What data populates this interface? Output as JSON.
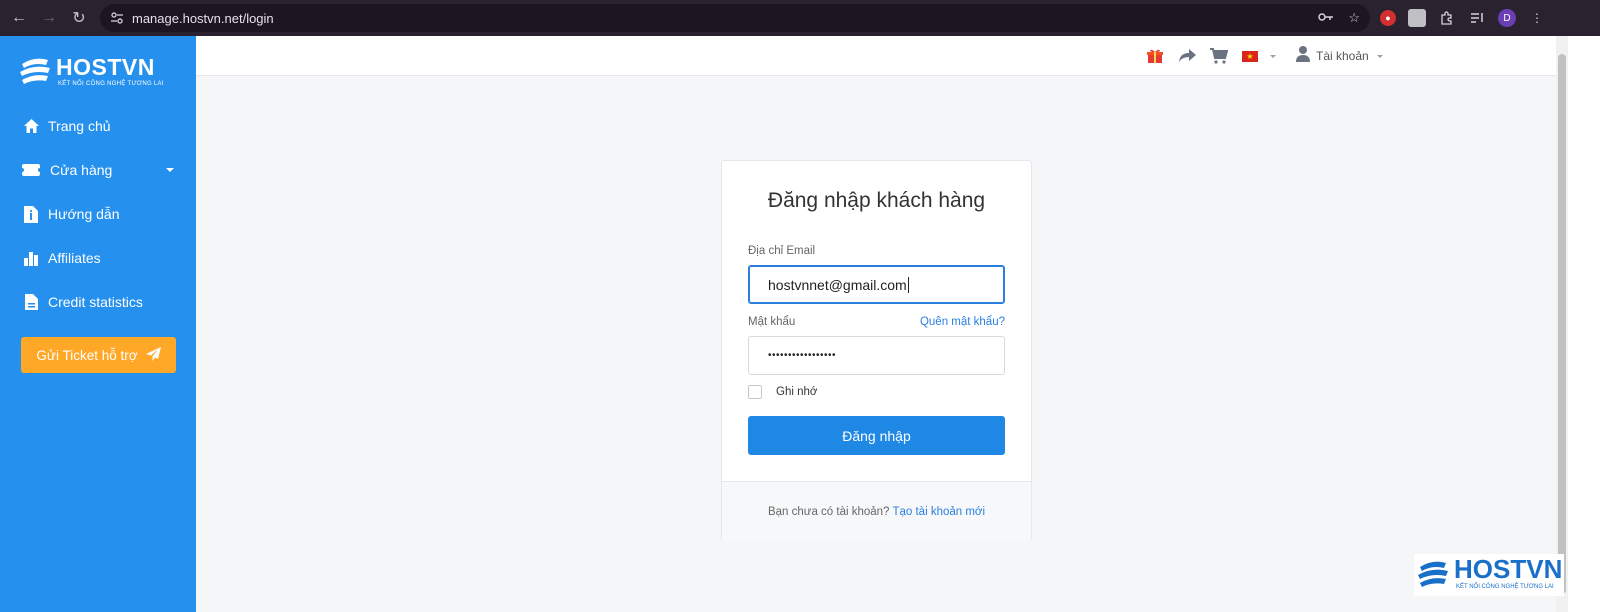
{
  "browser": {
    "url": "manage.hostvn.net/login",
    "profile_initial": "D"
  },
  "brand": {
    "name": "HOSTVN",
    "tagline": "KẾT NỐI CÔNG NGHỆ TƯƠNG LAI",
    "primary_color": "#2590ee",
    "accent_color": "#ffa726"
  },
  "sidebar": {
    "items": [
      {
        "label": "Trang chủ",
        "icon": "home-icon"
      },
      {
        "label": "Cửa hàng",
        "icon": "ticket-icon"
      },
      {
        "label": "Hướng dẫn",
        "icon": "document-info-icon"
      },
      {
        "label": "Affiliates",
        "icon": "bar-chart-icon"
      },
      {
        "label": "Credit statistics",
        "icon": "file-icon"
      }
    ],
    "ticket_button": "Gửi Ticket hỗ trợ"
  },
  "header": {
    "account_label": "Tài khoản"
  },
  "login": {
    "title": "Đăng nhập khách hàng",
    "email_label": "Địa chỉ Email",
    "email_value": "hostvnnet@gmail.com",
    "password_label": "Mật khẩu",
    "forgot_link": "Quên mật khẩu?",
    "password_mask": "•••••••••••••••••",
    "remember_label": "Ghi nhớ",
    "submit_label": "Đăng nhập",
    "no_account_text": "Bạn chưa có tài khoản?",
    "register_link": "Tạo tài khoản mới"
  }
}
